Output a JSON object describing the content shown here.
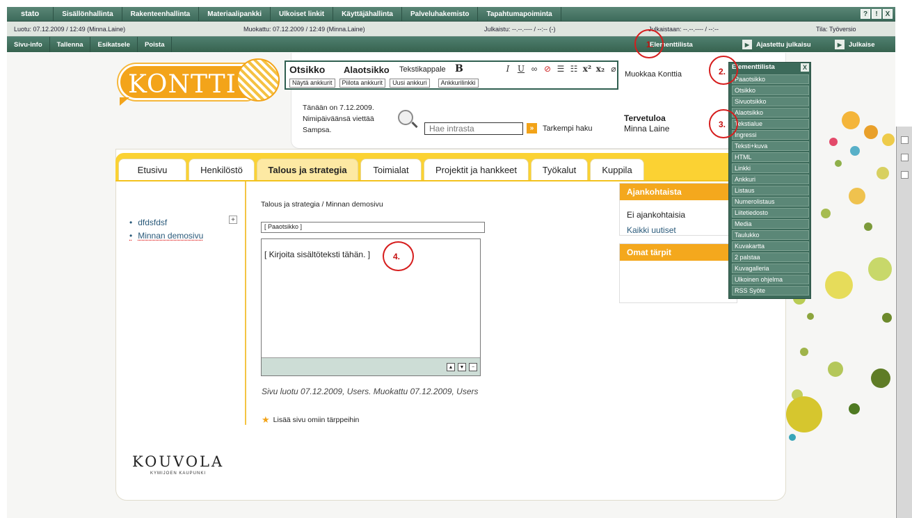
{
  "admin": {
    "menu": [
      "stato",
      "Sisällönhallinta",
      "Rakenteenhallinta",
      "Materiaalipankki",
      "Ulkoiset linkit",
      "Käyttäjähallinta",
      "Palveluhakemisto",
      "Tapahtumapoiminta"
    ],
    "window_buttons": [
      "?",
      "!",
      "X"
    ],
    "info": {
      "created": "Luotu: 07.12.2009 / 12:49 (Minna.Laine)",
      "modified": "Muokattu: 07.12.2009 / 12:49 (Minna.Laine)",
      "published": "Julkaistu: --.--.---- / --:-- (-)",
      "to_publish": "Julkaistaan: --.--.---- / --:--",
      "status": "Tila: Työversio"
    },
    "actions": [
      "Sivu-info",
      "Tallenna",
      "Esikatsele",
      "Poista"
    ],
    "right_actions": {
      "element_list": "Elementtilista",
      "scheduled": "Ajastettu julkaisu",
      "publish": "Julkaise"
    }
  },
  "logo": {
    "text": "KONTTI"
  },
  "editor_toolbar": {
    "styles": [
      "Otsikko",
      "Alaotsikko",
      "Tekstikappale",
      "B"
    ],
    "format_icons": [
      "italic-icon",
      "underline-icon",
      "link-icon",
      "unlink-icon",
      "bullet-list-icon",
      "numbered-list-icon",
      "superscript-icon",
      "subscript-icon",
      "attachment-icon"
    ],
    "format_glyphs": [
      "I",
      "U",
      "∞",
      "⊘",
      "☰",
      "☷",
      "x²",
      "x₂",
      "⌀"
    ],
    "anchor_buttons": [
      "Näytä ankkurit",
      "Piilota ankkurit",
      "Uusi ankkuri",
      "Ankkurilinkki"
    ]
  },
  "header": {
    "edit_link": "Muokkaa Konttia",
    "date_line1": "Tänään on 7.12.2009.",
    "date_line2": "Nimipäiväänsä viettää",
    "date_line3": "Sampsa.",
    "search_placeholder": "Hae intrasta",
    "go_label": "»",
    "advanced_search": "Tarkempi haku",
    "welcome_title": "Tervetuloa",
    "welcome_user": "Minna Laine"
  },
  "tabs": [
    "Etusivu",
    "Henkilöstö",
    "Talous ja strategia",
    "Toimialat",
    "Projektit ja hankkeet",
    "Työkalut",
    "Kuppila"
  ],
  "active_tab": "Talous ja strategia",
  "nav": {
    "items": [
      "dfdsfdsf",
      "Minnan demosivu"
    ],
    "expand_label": "+"
  },
  "content": {
    "breadcrumb": "Talous ja strategia / Minnan demosivu",
    "heading_placeholder": "[ Paaotsikko ]",
    "body_placeholder": "[ Kirjoita sisältöteksti tähän. ]",
    "editor_controls": [
      "▲",
      "▼",
      "−"
    ],
    "meta": "Sivu luotu 07.12.2009, Users. Muokattu 07.12.2009, Users",
    "favorite": "Lisää sivu omiin tärppeihin"
  },
  "news": {
    "title": "Ajankohtaista",
    "empty": "Ei ajankohtaisia",
    "all_link": "Kaikki uutiset"
  },
  "tips": {
    "title": "Omat tärpit"
  },
  "element_list": {
    "title": "Elementtilista",
    "close": "X",
    "items": [
      "Paaotsikko",
      "Otsikko",
      "Sivuotsikko",
      "Alaotsikko",
      "Tekstialue",
      "Ingressi",
      "Teksti+kuva",
      "HTML",
      "Linkki",
      "Ankkuri",
      "Listaus",
      "Numerolistaus",
      "Liitetiedosto",
      "Media",
      "Taulukko",
      "Kuvakartta",
      "2 palstaa",
      "Kuvagalleria",
      "Ulkoinen ohjelma",
      "RSS Syöte"
    ]
  },
  "annotations": [
    "1.",
    "2.",
    "3.",
    "4."
  ],
  "footer_logo": {
    "name": "KOUVOLA",
    "tagline": "KYMIJOEN KAUPUNKI"
  },
  "colors": {
    "admin_green": "#3f6f5f",
    "accent_orange": "#f4a81d",
    "tab_yellow": "#fbd233",
    "annotation_red": "#d61d1d"
  }
}
